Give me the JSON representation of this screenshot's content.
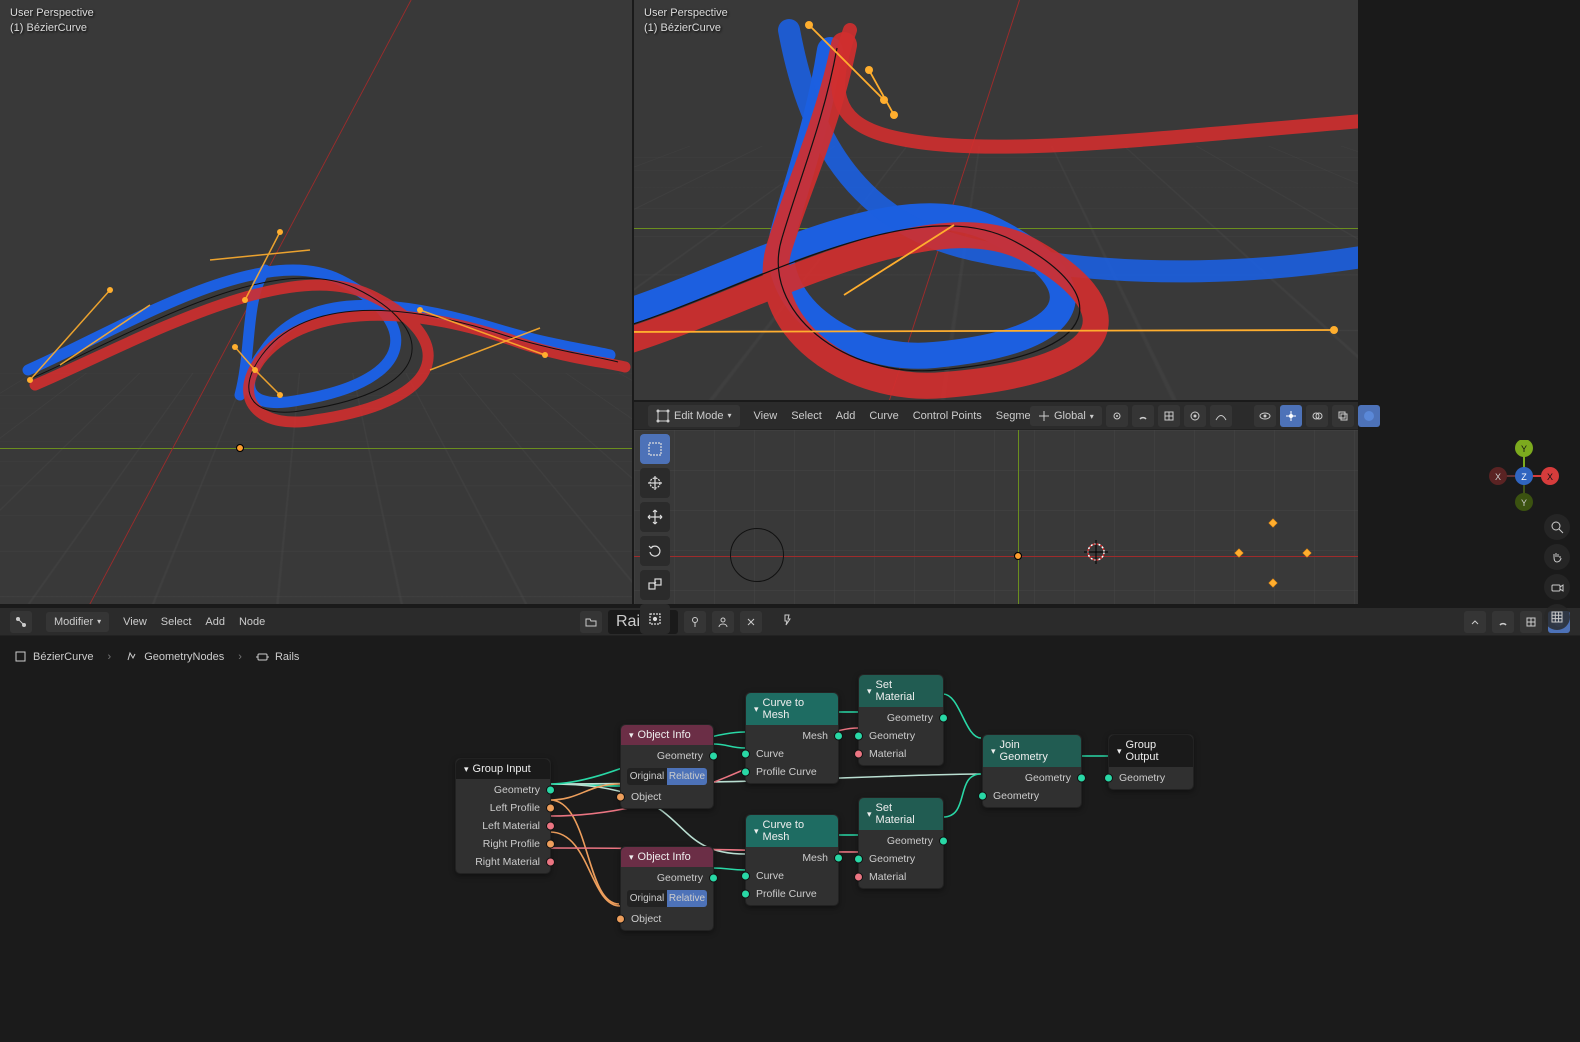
{
  "viewport_tl": {
    "view": "User Perspective",
    "object": "(1) BézierCurve"
  },
  "viewport_tr": {
    "view": "User Perspective",
    "object": "(1) BézierCurve"
  },
  "editor_header": {
    "mode_icon": "edit-mode-icon",
    "mode": "Edit Mode",
    "menus": [
      "View",
      "Select",
      "Add",
      "Curve",
      "Control Points",
      "Segments"
    ],
    "orientation": "Global"
  },
  "gizmo_axes": {
    "x_pos": "X",
    "x_neg": "X",
    "y_pos": "Y",
    "y_neg": "Y",
    "z_pos": "Z",
    "z_neg": "Z"
  },
  "node_header": {
    "type": "Modifier",
    "menus": [
      "View",
      "Select",
      "Add",
      "Node"
    ],
    "tree_name": "Rails"
  },
  "breadcrumb": {
    "object": "BézierCurve",
    "modifier": "GeometryNodes",
    "group": "Rails"
  },
  "nodes": {
    "group_input": {
      "title": "Group Input",
      "outputs": [
        "Geometry",
        "Left Profile",
        "Left Material",
        "Right Profile",
        "Right Material"
      ]
    },
    "object_info_1": {
      "title": "Object Info",
      "out_geometry": "Geometry",
      "in_object": "Object",
      "mode_original": "Original",
      "mode_relative": "Relative"
    },
    "object_info_2": {
      "title": "Object Info",
      "out_geometry": "Geometry",
      "in_object": "Object",
      "mode_original": "Original",
      "mode_relative": "Relative"
    },
    "curve_to_mesh_1": {
      "title": "Curve to Mesh",
      "out_mesh": "Mesh",
      "in_curve": "Curve",
      "in_profile": "Profile Curve"
    },
    "curve_to_mesh_2": {
      "title": "Curve to Mesh",
      "out_mesh": "Mesh",
      "in_curve": "Curve",
      "in_profile": "Profile Curve"
    },
    "set_material_1": {
      "title": "Set Material",
      "out_geometry": "Geometry",
      "in_geometry": "Geometry",
      "in_material": "Material"
    },
    "set_material_2": {
      "title": "Set Material",
      "out_geometry": "Geometry",
      "in_geometry": "Geometry",
      "in_material": "Material"
    },
    "join_geometry": {
      "title": "Join Geometry",
      "out_geometry": "Geometry",
      "in_geometry": "Geometry"
    },
    "group_output": {
      "title": "Group Output",
      "in_geometry": "Geometry"
    }
  }
}
